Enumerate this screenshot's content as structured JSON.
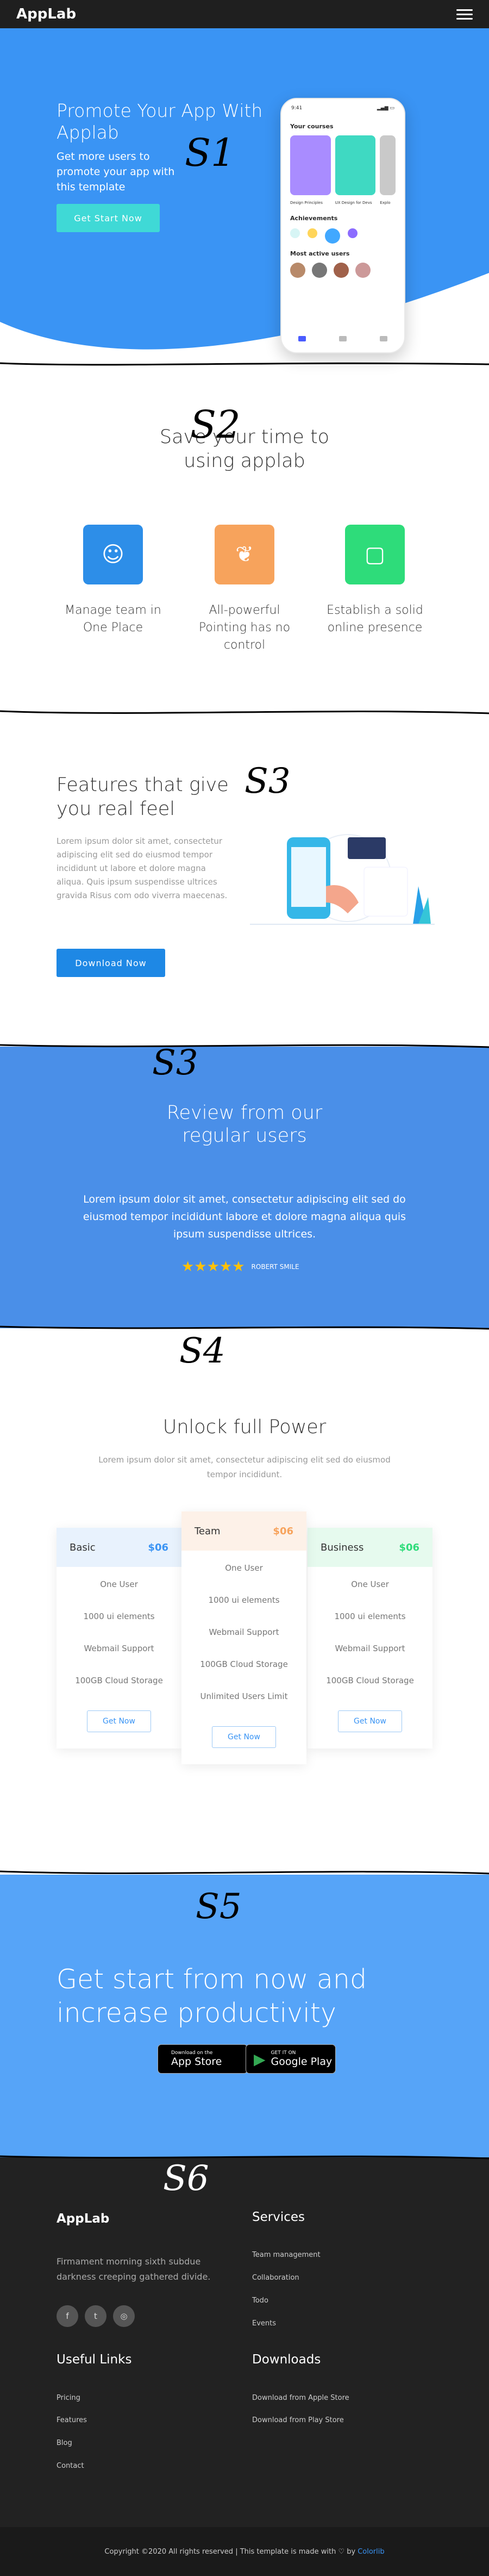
{
  "nav": {
    "brand": "AppLab"
  },
  "hero": {
    "title": "Promote Your App With Applab",
    "subtitle": "Get more users to promote your app with this template",
    "button": "Get Start Now",
    "phone": {
      "time": "9:41",
      "courses_title": "Your courses",
      "card1": "Design Principles",
      "card2": "UX Design for Devs",
      "card3": "Explo",
      "achievements": "Achievements",
      "active_users": "Most active users"
    }
  },
  "section2": {
    "title": "Save your time to using applab",
    "features": [
      {
        "label": "Manage team in One Place"
      },
      {
        "label": "All-powerful Pointing has no control"
      },
      {
        "label": "Establish a solid online presence"
      }
    ]
  },
  "section3": {
    "title": "Features that give you real feel",
    "body": "Lorem ipsum dolor sit amet, consectetur adipiscing elit sed do eiusmod tempor incididunt ut labore et dolore magna aliqua. Quis ipsum suspendisse ultrices gravida Risus com odo viverra maecenas.",
    "button": "Download Now"
  },
  "reviews": {
    "title": "Review from our regular users",
    "quote": "Lorem ipsum dolor sit amet, consectetur adipiscing elit sed do eiusmod tempor incididunt labore et dolore magna aliqua quis ipsum suspendisse ultrices.",
    "stars": "★★★★★",
    "author": "ROBERT SMILE"
  },
  "pricing": {
    "title": "Unlock full Power",
    "subtitle": "Lorem ipsum dolor sit amet, consectetur adipiscing elit sed do eiusmod tempor incididunt.",
    "plans": [
      {
        "name": "Basic",
        "price": "$06",
        "features": [
          "One User",
          "1000 ui elements",
          "Webmail Support",
          "100GB Cloud Storage"
        ],
        "button": "Get Now"
      },
      {
        "name": "Team",
        "price": "$06",
        "features": [
          "One User",
          "1000 ui elements",
          "Webmail Support",
          "100GB Cloud Storage",
          "Unlimited Users Limit"
        ],
        "button": "Get Now"
      },
      {
        "name": "Business",
        "price": "$06",
        "features": [
          "One User",
          "1000 ui elements",
          "Webmail Support",
          "100GB Cloud Storage"
        ],
        "button": "Get Now"
      }
    ]
  },
  "cta": {
    "title": "Get start from now and increase productivity",
    "appstore_small": "Download on the",
    "appstore": "App Store",
    "playstore_small": "GET IT ON",
    "playstore": "Google Play"
  },
  "footer": {
    "brand": "AppLab",
    "about": "Firmament morning sixth subdue darkness creeping gathered divide.",
    "services_title": "Services",
    "services": [
      "Team management",
      "Collaboration",
      "Todo",
      "Events"
    ],
    "links_title": "Useful Links",
    "links": [
      "Pricing",
      "Features",
      "Blog",
      "Contact"
    ],
    "downloads_title": "Downloads",
    "downloads": [
      "Download from Apple Store",
      "Download from Play Store"
    ],
    "social": [
      "f",
      "t",
      "◎"
    ],
    "copyright": "Copyright ©2020 All rights reserved | This template is made with ♡ by",
    "credit": "Colorlib"
  },
  "annotations": [
    "S1",
    "S2",
    "S3",
    "S3",
    "S4",
    "S5",
    "S6"
  ],
  "colors": {
    "primary": "#3a94f4",
    "dark": "#222222",
    "teal": "#3fd9d6"
  }
}
